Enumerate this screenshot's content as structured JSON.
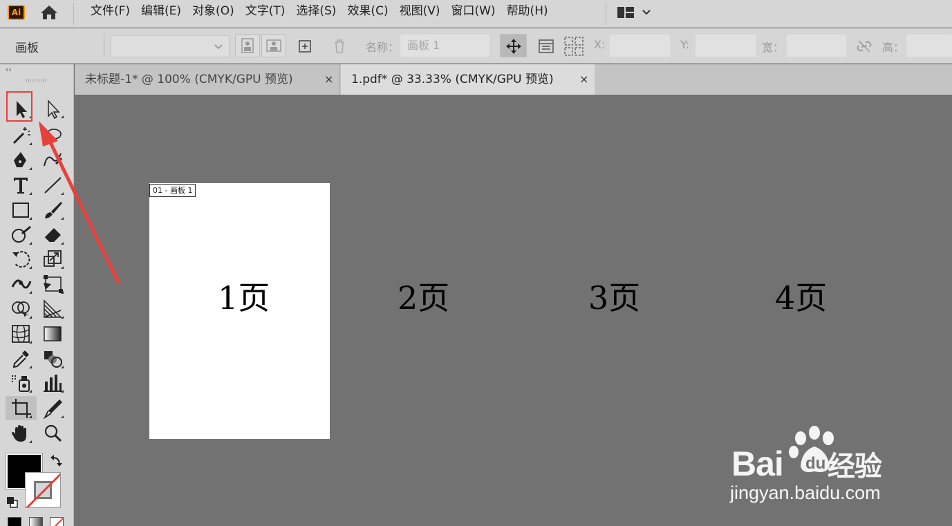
{
  "menubar": {
    "logo_text": "Ai",
    "items": [
      "文件(F)",
      "编辑(E)",
      "对象(O)",
      "文字(T)",
      "选择(S)",
      "效果(C)",
      "视图(V)",
      "窗口(W)",
      "帮助(H)"
    ]
  },
  "controlbar": {
    "context_label": "画板",
    "name_label": "名称：",
    "name_value": "画板 1",
    "x_label": "X:",
    "y_label": "Y:",
    "w_label": "宽：",
    "h_label": "高："
  },
  "tabs": [
    {
      "label": "未标题-1* @ 100% (CMYK/GPU 预览)",
      "close": "×",
      "active": false
    },
    {
      "label": "1.pdf* @ 33.33% (CMYK/GPU 预览)",
      "close": "×",
      "active": true
    }
  ],
  "canvas": {
    "artboard_label": "01 - 画板 1",
    "pages": [
      "1页",
      "2页",
      "3页",
      "4页"
    ]
  },
  "toolbar": {
    "collapse": "‹‹",
    "fill_color": "#000000",
    "stroke_color": "none"
  },
  "watermark": {
    "brand": "Bai",
    "brand_suffix": "经验",
    "url": "jingyan.baidu.com"
  },
  "colors": {
    "highlight": "#e8403b",
    "canvas": "#727272",
    "panel": "#d6d6d6"
  }
}
